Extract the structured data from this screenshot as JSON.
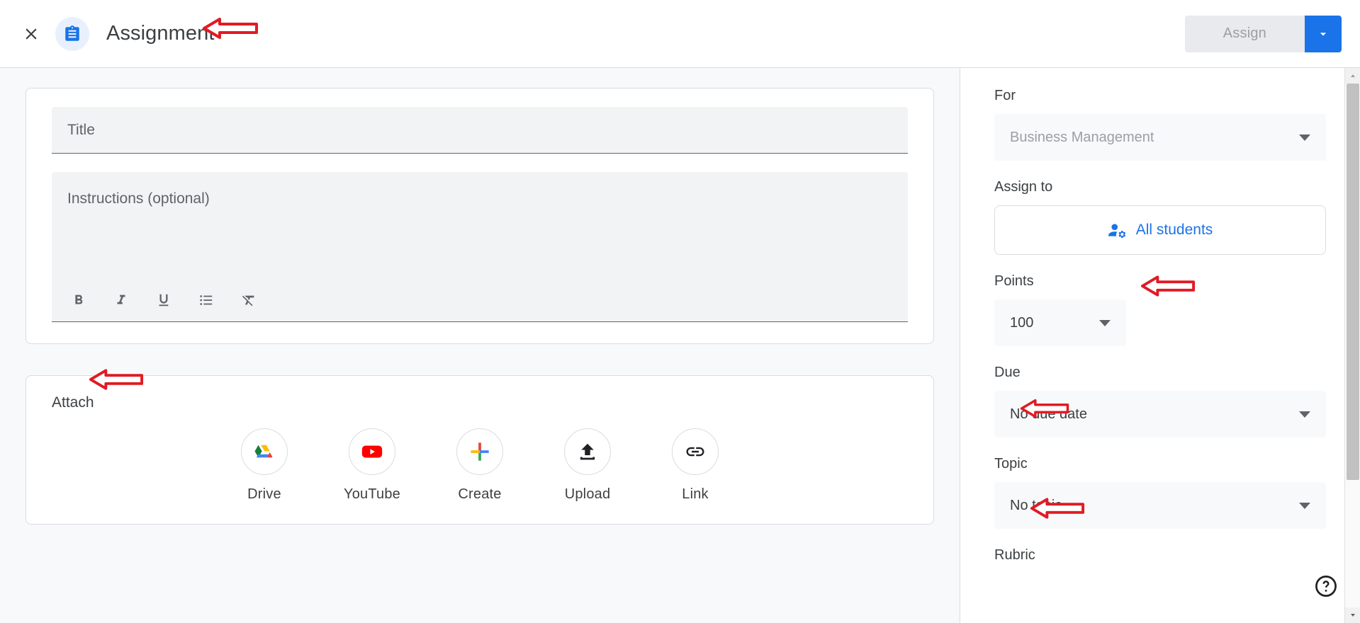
{
  "header": {
    "close_icon": "close-icon",
    "doc_icon": "assignment-clipboard-icon",
    "title": "Assignment",
    "assign_label": "Assign",
    "assign_dropdown_icon": "chevron-down-icon"
  },
  "editor": {
    "title_placeholder": "Title",
    "instructions_placeholder": "Instructions (optional)",
    "format_buttons": [
      {
        "name": "bold-button",
        "glyph": "B"
      },
      {
        "name": "italic-button",
        "glyph": "I"
      },
      {
        "name": "underline-button",
        "glyph": "U"
      },
      {
        "name": "bulleted-list-button",
        "glyph": "list"
      },
      {
        "name": "clear-formatting-button",
        "glyph": "clear"
      }
    ]
  },
  "attach": {
    "label": "Attach",
    "items": [
      {
        "label": "Drive",
        "icon": "google-drive-icon"
      },
      {
        "label": "YouTube",
        "icon": "youtube-icon"
      },
      {
        "label": "Create",
        "icon": "google-plus-create-icon"
      },
      {
        "label": "Upload",
        "icon": "upload-icon"
      },
      {
        "label": "Link",
        "icon": "link-icon"
      }
    ]
  },
  "sidebar": {
    "for_label": "For",
    "for_value": "Business Management",
    "assign_to_label": "Assign to",
    "all_students_label": "All students",
    "all_students_icon": "people-settings-icon",
    "points_label": "Points",
    "points_value": "100",
    "due_label": "Due",
    "due_value": "No due date",
    "topic_label": "Topic",
    "topic_value": "No topic",
    "rubric_label": "Rubric"
  },
  "help": {
    "icon": "help-question-icon"
  },
  "scrollbar": {
    "up_icon": "scroll-up-arrow-icon",
    "down_icon": "scroll-down-arrow-icon"
  },
  "annotations": {
    "color": "#e01b24",
    "arrows": [
      {
        "name": "arrow-pointing-to-assignment-title"
      },
      {
        "name": "arrow-pointing-to-attach"
      },
      {
        "name": "arrow-pointing-to-points"
      },
      {
        "name": "arrow-pointing-to-due"
      },
      {
        "name": "arrow-pointing-to-topic"
      }
    ]
  }
}
